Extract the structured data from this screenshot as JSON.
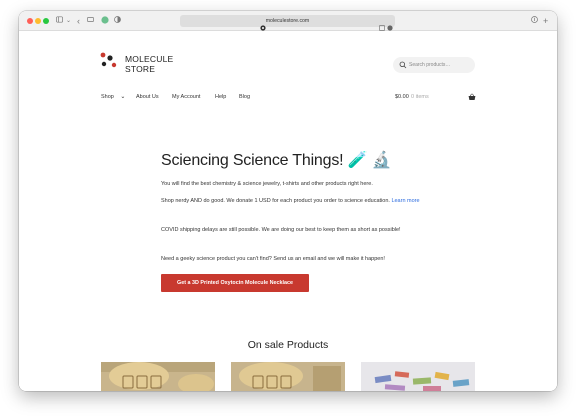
{
  "browser": {
    "url": "moleculestore.com",
    "traffic_lights": {
      "close": "#ff5f57",
      "minimize": "#febc2e",
      "zoom": "#28c840"
    }
  },
  "site": {
    "logo": {
      "line1": "MOLECULE",
      "line2": "STORE"
    },
    "search": {
      "placeholder": "Search products…"
    },
    "nav": [
      {
        "label": "Shop"
      },
      {
        "label": "About Us"
      },
      {
        "label": "My Account"
      },
      {
        "label": "Help"
      },
      {
        "label": "Blog"
      }
    ],
    "cart": {
      "total": "$0.00",
      "items": "0 items"
    }
  },
  "hero": {
    "title": "Sciencing Science Things! 🧪 🔬",
    "p1": "You will find the best chemistry & science jewelry, t-shirts and other products right here.",
    "p2": "Shop nerdy AND do good. We donate 1 USD for each product you order to science education.",
    "p2_link": "Learn more",
    "p3": "COVID shipping delays are still possible. We are doing our best to keep them as short as possible!",
    "p4": "Need a geeky science product you can't find? Send us an email and we will make it happen!",
    "cta": "Get a 3D Printed Oxytocin Molecule Necklace",
    "cta_color": "#c8392f"
  },
  "sale": {
    "heading": "On sale Products",
    "products": [
      {
        "image": "cookie-cutter-photo-1"
      },
      {
        "image": "cookie-cutter-photo-2"
      },
      {
        "image": "science-stickers-photo"
      }
    ]
  }
}
